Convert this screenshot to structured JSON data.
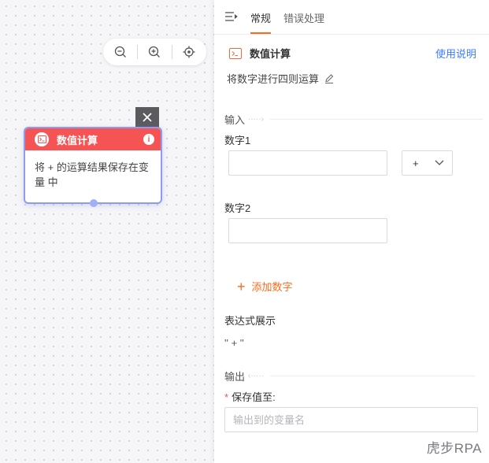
{
  "canvas": {
    "zoom_tools": [
      "zoom-out",
      "zoom-in",
      "locate"
    ],
    "close_symbol": "✕",
    "node": {
      "title": "数值计算",
      "info_symbol": "i",
      "body": "将 + 的运算结果保存在变量 中",
      "header_color": "#f65454"
    }
  },
  "panel": {
    "tabs": [
      {
        "label": "常规",
        "active": true
      },
      {
        "label": "错误处理",
        "active": false
      }
    ],
    "title": "数值计算",
    "help_link": "使用说明",
    "description": "将数字进行四则运算",
    "input_group": "输入",
    "fields": [
      {
        "label": "数字1",
        "value": ""
      },
      {
        "label": "数字2",
        "value": ""
      }
    ],
    "operator": {
      "selected": "+"
    },
    "add_number": "添加数字",
    "expression_label": "表达式展示",
    "expression_value": "'' + ''",
    "output_group": "输出",
    "save_label": "保存值至:",
    "save_placeholder": "输出到的变量名",
    "accent_color": "#ff6a1a",
    "link_color": "#3b7cff"
  },
  "watermark": "虎步RPA"
}
